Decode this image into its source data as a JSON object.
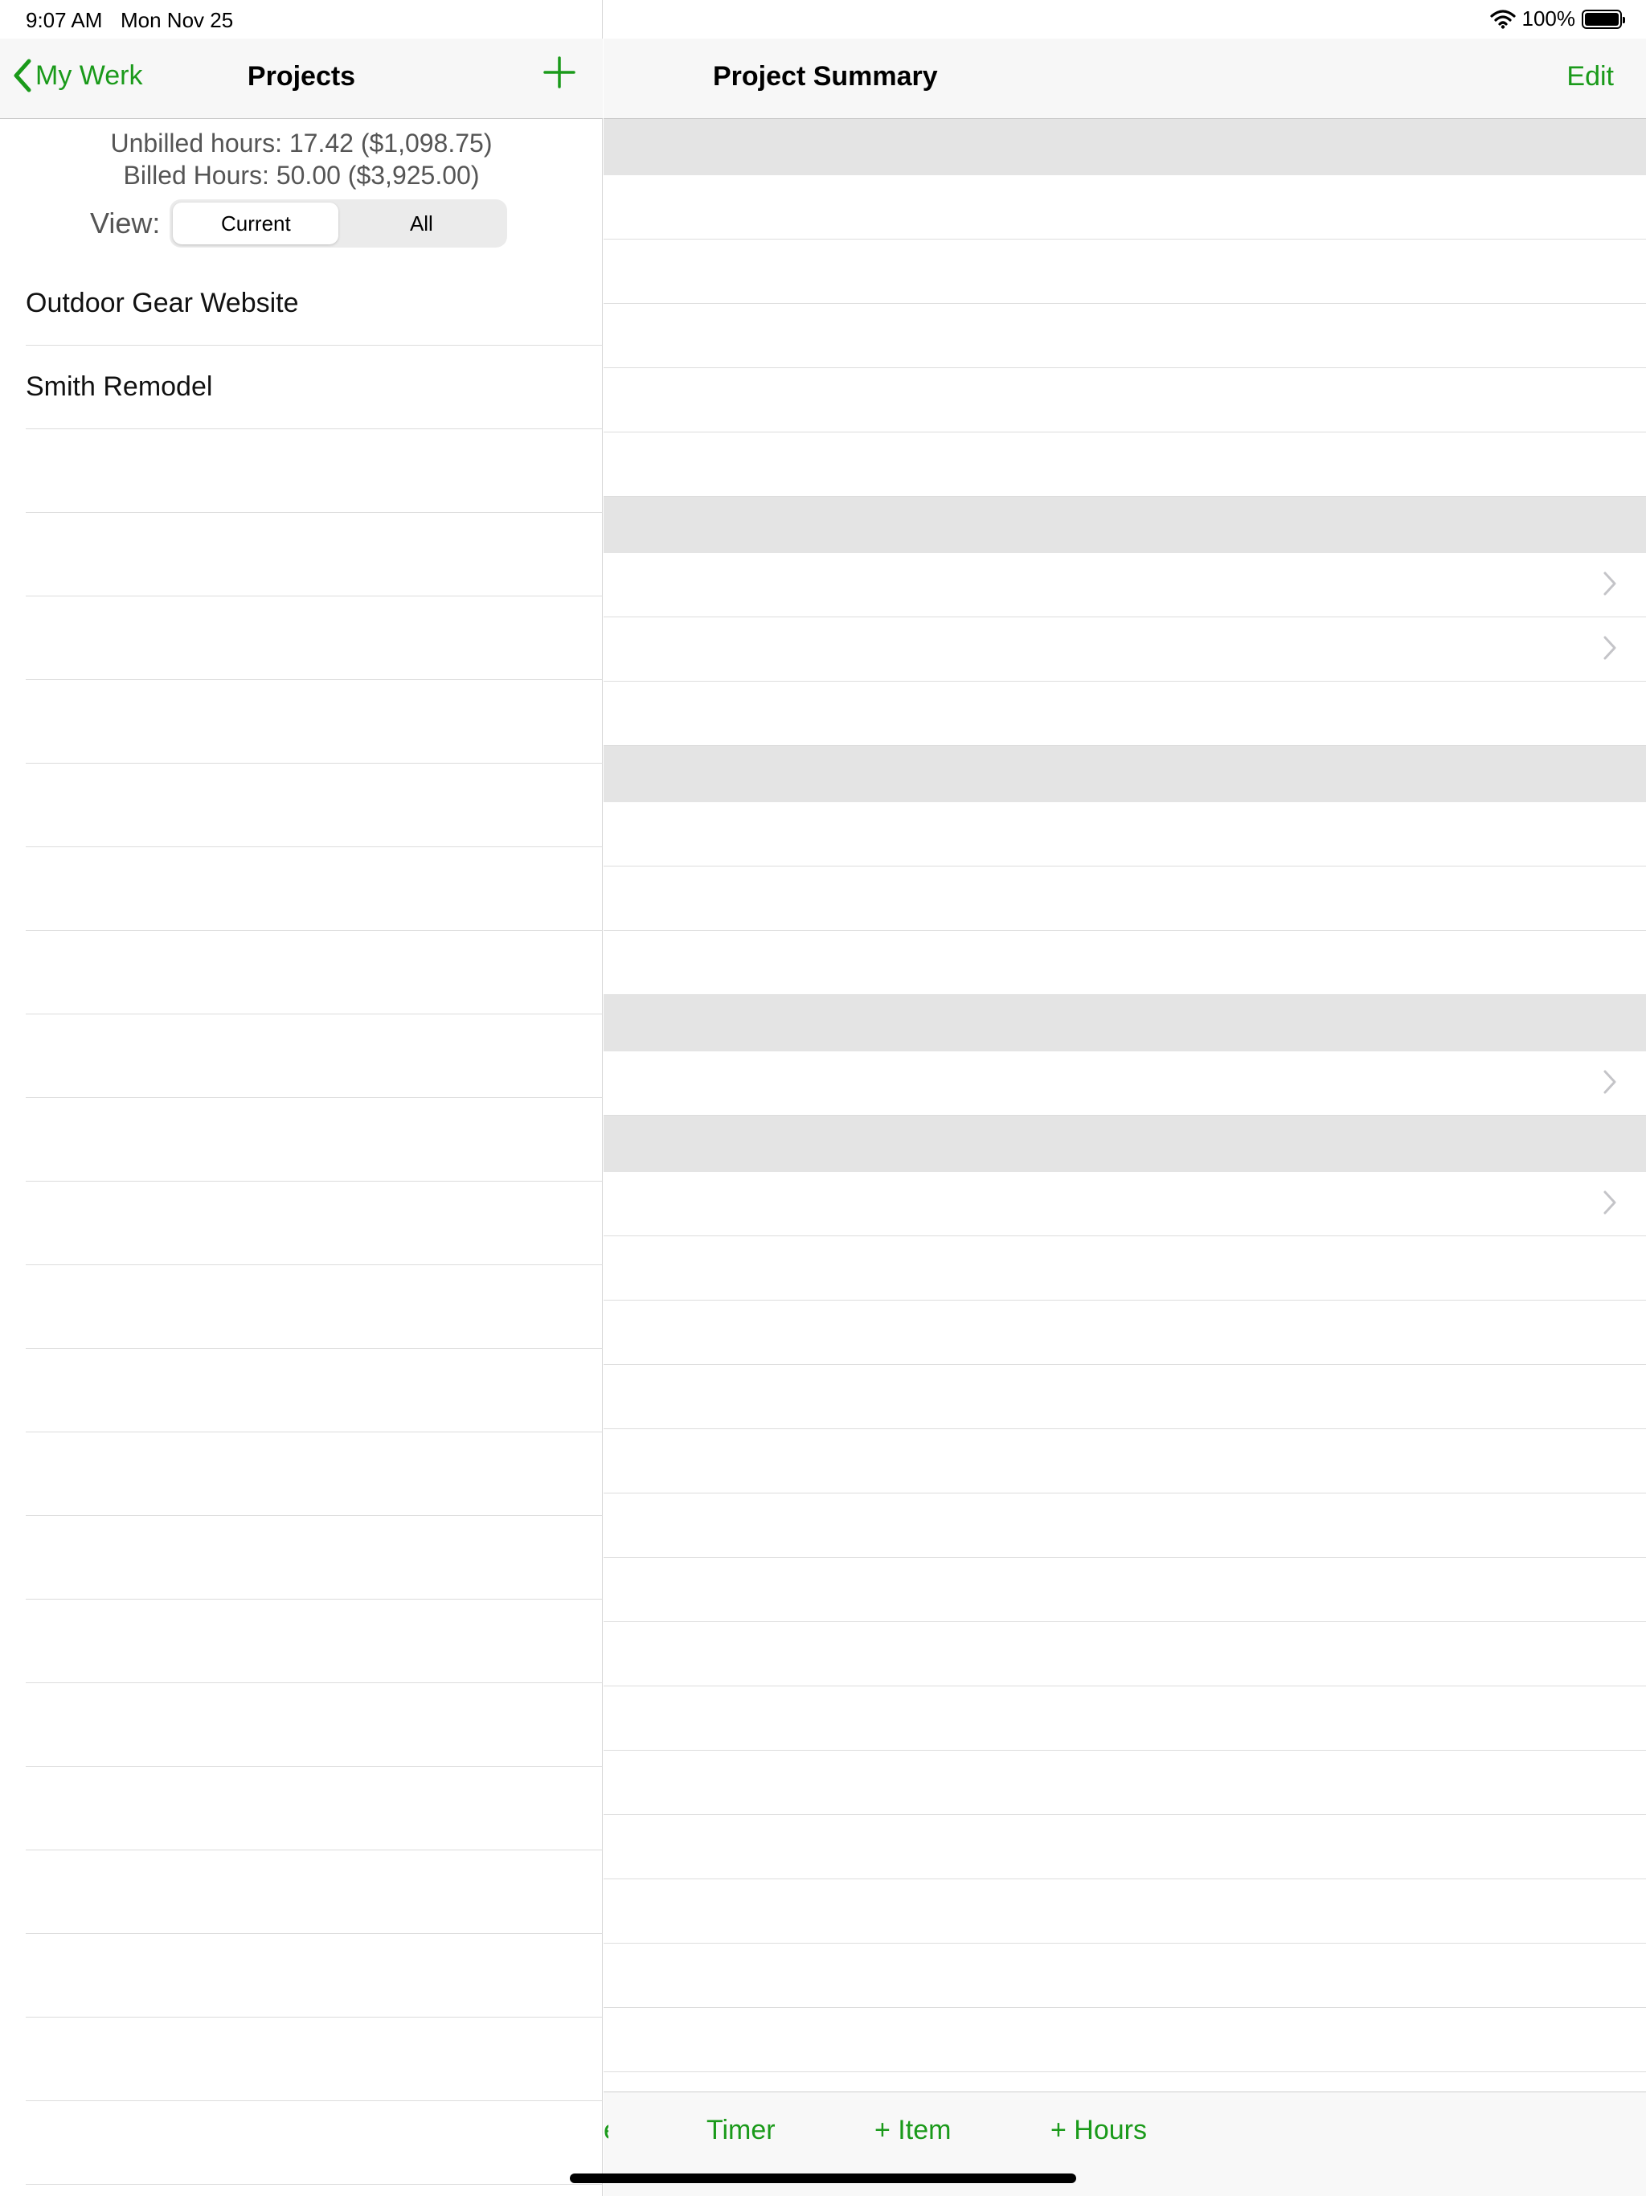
{
  "status_bar": {
    "time": "9:07 AM",
    "date": "Mon Nov 25",
    "battery": "100%",
    "battery_level": 1.0
  },
  "left_nav": {
    "back_label": "My Werk",
    "title": "Projects"
  },
  "totals": {
    "unbilled": "Unbilled hours: 17.42 ($1,098.75)",
    "billed": "Billed Hours: 50.00 ($3,925.00)"
  },
  "view_filter": {
    "label": "View:",
    "options": [
      "Current",
      "All"
    ],
    "selected": "Current"
  },
  "projects": [
    {
      "name": "Outdoor Gear Website"
    },
    {
      "name": "Smith Remodel"
    }
  ],
  "right_nav": {
    "title": "Project Summary",
    "edit_label": "Edit"
  },
  "toolbar": {
    "partial_label": "e",
    "timer_label": "Timer",
    "item_label": "+ Item",
    "hours_label": "+ Hours"
  },
  "colors": {
    "accent": "#1a9a1a",
    "section_header": "#e4e4e4",
    "separator": "#dcdcdc"
  }
}
